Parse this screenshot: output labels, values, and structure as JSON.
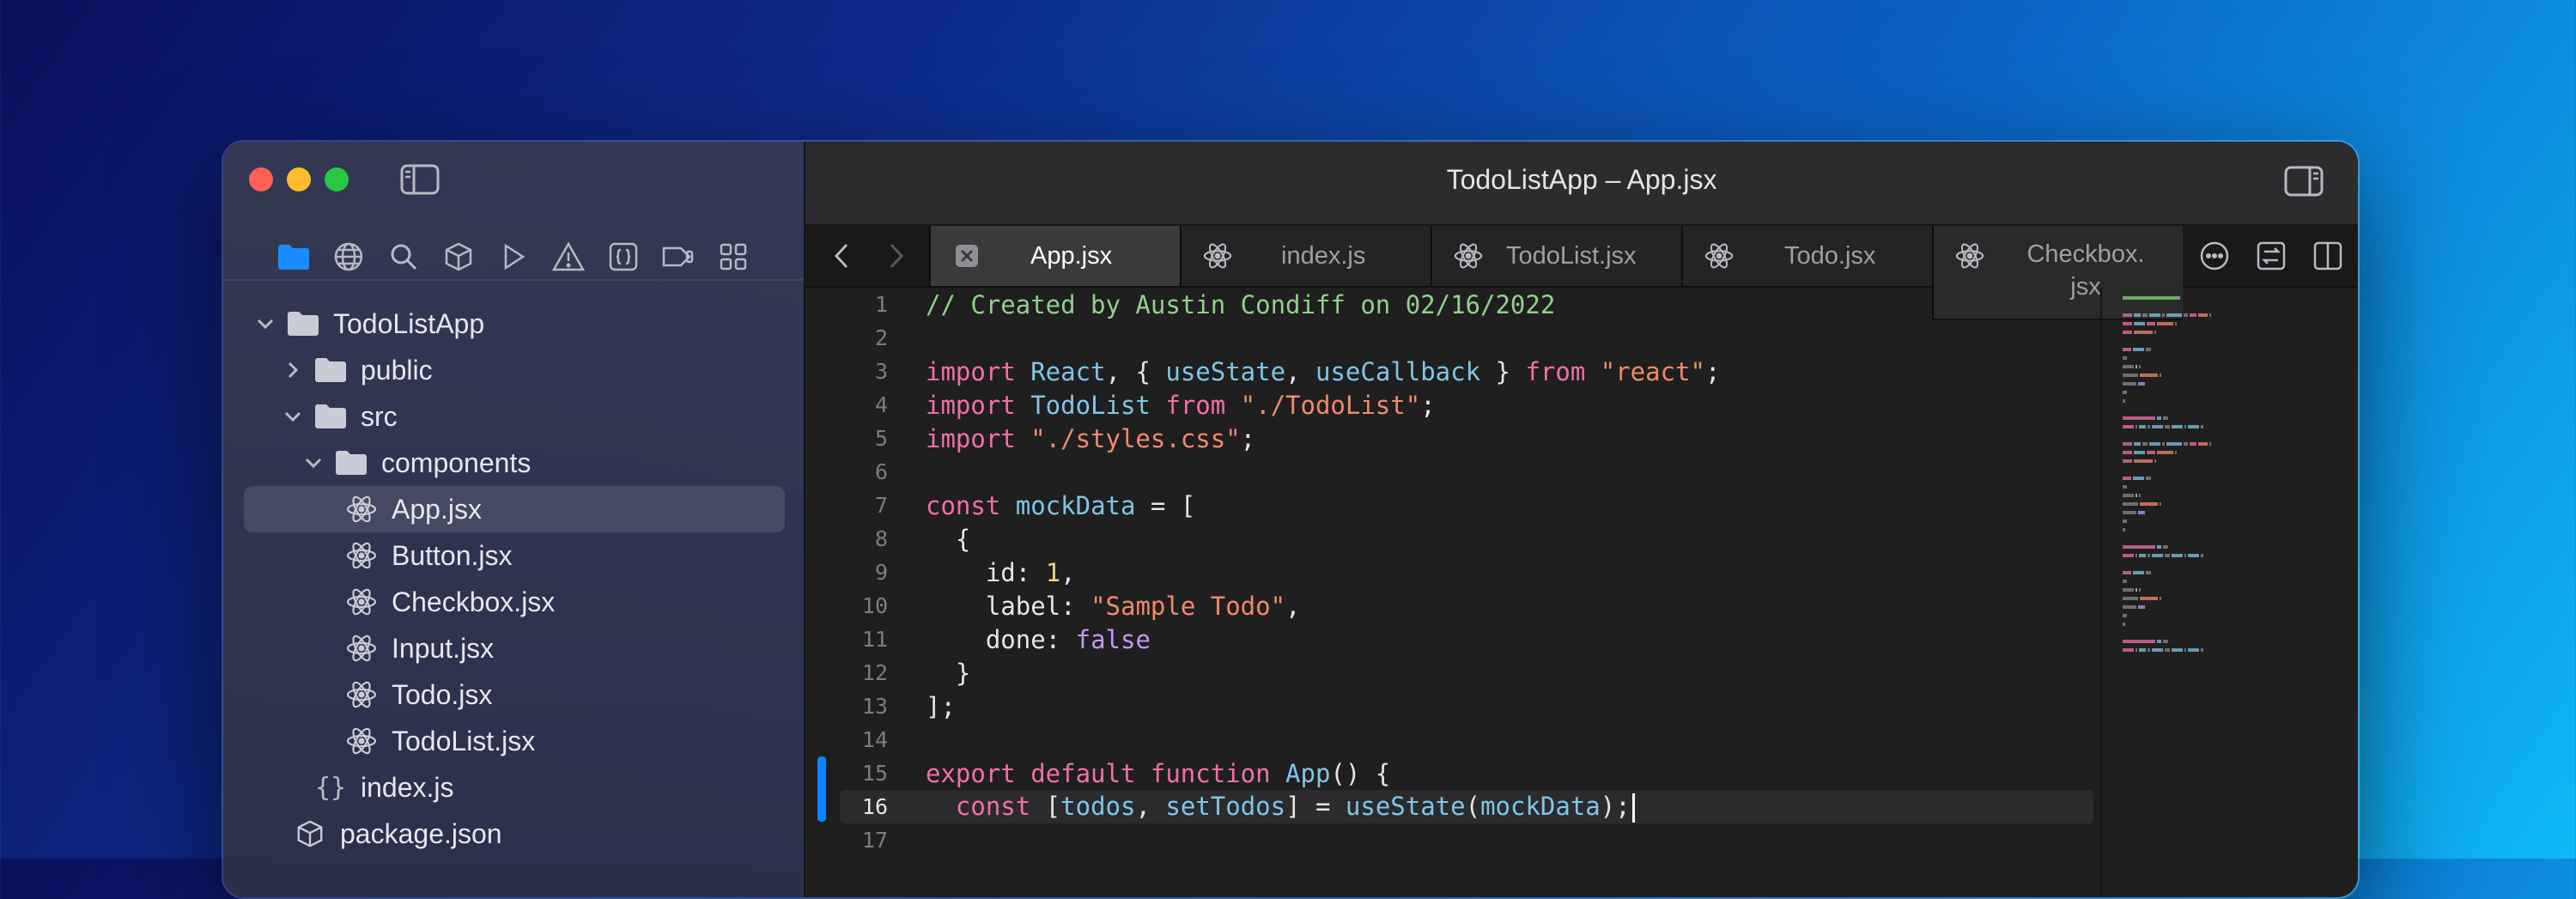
{
  "window": {
    "title": "TodoListApp – App.jsx"
  },
  "sidebar": {
    "nav_icons": [
      "folder-icon",
      "globe-icon",
      "search-icon",
      "cube-icon",
      "play-icon",
      "warning-icon",
      "braces-icon",
      "tag-icon",
      "grid-icon"
    ],
    "tree": [
      {
        "label": "TodoListApp",
        "type": "folder",
        "depth": 0,
        "expanded": true
      },
      {
        "label": "public",
        "type": "folder",
        "depth": 1,
        "expanded": false
      },
      {
        "label": "src",
        "type": "folder",
        "depth": 1,
        "expanded": true
      },
      {
        "label": "components",
        "type": "folder",
        "depth": 2,
        "expanded": true
      },
      {
        "label": "App.jsx",
        "type": "react",
        "depth": 3,
        "selected": true
      },
      {
        "label": "Button.jsx",
        "type": "react",
        "depth": 3
      },
      {
        "label": "Checkbox.jsx",
        "type": "react",
        "depth": 3
      },
      {
        "label": "Input.jsx",
        "type": "react",
        "depth": 3
      },
      {
        "label": "Todo.jsx",
        "type": "react",
        "depth": 3
      },
      {
        "label": "TodoList.jsx",
        "type": "react",
        "depth": 3
      },
      {
        "label": "index.js",
        "type": "js",
        "depth": 2
      },
      {
        "label": "package.json",
        "type": "package",
        "depth": 1
      }
    ]
  },
  "tabs": [
    {
      "label": "App.jsx",
      "active": true,
      "icon": "close-icon"
    },
    {
      "label": "index.js",
      "active": false,
      "icon": "react-icon"
    },
    {
      "label": "TodoList.jsx",
      "active": false,
      "icon": "react-icon"
    },
    {
      "label": "Todo.jsx",
      "active": false,
      "icon": "react-icon"
    },
    {
      "label": "Checkbox.\njsx",
      "active": false,
      "icon": "react-icon"
    }
  ],
  "code": {
    "current_line": 16,
    "lines": [
      {
        "n": "1",
        "tokens": [
          [
            "comment",
            "// Created by Austin Condiff on 02/16/2022"
          ]
        ]
      },
      {
        "n": "2",
        "tokens": []
      },
      {
        "n": "3",
        "tokens": [
          [
            "kw",
            "import "
          ],
          [
            "id",
            "React"
          ],
          [
            "plain",
            ", { "
          ],
          [
            "id",
            "useState"
          ],
          [
            "plain",
            ", "
          ],
          [
            "id",
            "useCallback"
          ],
          [
            "plain",
            " } "
          ],
          [
            "kw",
            "from "
          ],
          [
            "str",
            "\"react\""
          ],
          [
            "plain",
            ";"
          ]
        ]
      },
      {
        "n": "4",
        "tokens": [
          [
            "kw",
            "import "
          ],
          [
            "id",
            "TodoList"
          ],
          [
            "kw",
            " from "
          ],
          [
            "str",
            "\"./TodoList\""
          ],
          [
            "plain",
            ";"
          ]
        ]
      },
      {
        "n": "5",
        "tokens": [
          [
            "kw",
            "import "
          ],
          [
            "str",
            "\"./styles.css\""
          ],
          [
            "plain",
            ";"
          ]
        ]
      },
      {
        "n": "6",
        "tokens": []
      },
      {
        "n": "7",
        "tokens": [
          [
            "kw",
            "const "
          ],
          [
            "id",
            "mockData"
          ],
          [
            "plain",
            " = ["
          ]
        ]
      },
      {
        "n": "8",
        "tokens": [
          [
            "plain",
            "  {"
          ]
        ]
      },
      {
        "n": "9",
        "tokens": [
          [
            "plain",
            "    id: "
          ],
          [
            "num",
            "1"
          ],
          [
            "plain",
            ","
          ]
        ]
      },
      {
        "n": "10",
        "tokens": [
          [
            "plain",
            "    label: "
          ],
          [
            "str",
            "\"Sample Todo\""
          ],
          [
            "plain",
            ","
          ]
        ]
      },
      {
        "n": "11",
        "tokens": [
          [
            "plain",
            "    done: "
          ],
          [
            "bool",
            "false"
          ]
        ]
      },
      {
        "n": "12",
        "tokens": [
          [
            "plain",
            "  }"
          ]
        ]
      },
      {
        "n": "13",
        "tokens": [
          [
            "plain",
            "];"
          ]
        ]
      },
      {
        "n": "14",
        "tokens": []
      },
      {
        "n": "15",
        "tokens": [
          [
            "kw",
            "export default function "
          ],
          [
            "id",
            "App"
          ],
          [
            "plain",
            "() {"
          ]
        ]
      },
      {
        "n": "16",
        "tokens": [
          [
            "kw",
            "  const "
          ],
          [
            "plain",
            "["
          ],
          [
            "id",
            "todos"
          ],
          [
            "plain",
            ", "
          ],
          [
            "id",
            "setTodos"
          ],
          [
            "plain",
            "] = "
          ],
          [
            "id",
            "useState"
          ],
          [
            "plain",
            "("
          ],
          [
            "id",
            "mockData"
          ],
          [
            "plain",
            ");"
          ]
        ]
      },
      {
        "n": "17",
        "tokens": []
      }
    ]
  },
  "colors": {
    "accent": "#0a84ff",
    "comment": "#8fd18a",
    "keyword": "#f26fa8",
    "identifier": "#7fc6e8",
    "string": "#f08a6a",
    "number": "#e8d57c",
    "boolean": "#c497f5"
  }
}
